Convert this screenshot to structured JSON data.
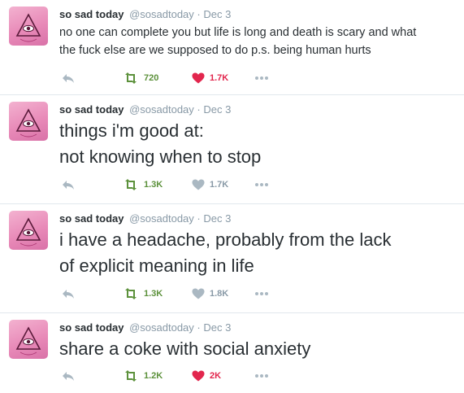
{
  "colors": {
    "retweet": "#5c913b",
    "like_active": "#e2264d",
    "muted": "#8899a6",
    "avatar_pink": "#e88ab8"
  },
  "icons": {
    "reply": "reply-icon",
    "retweet": "retweet-icon",
    "like": "heart-icon",
    "more": "more-dots-icon",
    "avatar": "all-seeing-eye-pyramid-icon"
  },
  "tweets": [
    {
      "fullname": "so sad today",
      "username": "@sosadtoday",
      "separator": "·",
      "time": "Dec 3",
      "text_lines": [
        "no one can complete you but life is long and death is scary and what",
        "the fuck else are we supposed to do p.s. being human hurts"
      ],
      "retweets": "720",
      "likes": "1.7K",
      "liked": true
    },
    {
      "fullname": "so sad today",
      "username": "@sosadtoday",
      "separator": "·",
      "time": "Dec 3",
      "text_lines": [
        "things i'm good at:",
        "not knowing when to stop"
      ],
      "retweets": "1.3K",
      "likes": "1.7K",
      "liked": false
    },
    {
      "fullname": "so sad today",
      "username": "@sosadtoday",
      "separator": "·",
      "time": "Dec 3",
      "text_lines": [
        "i have a headache, probably from the lack",
        "of explicit meaning in life"
      ],
      "retweets": "1.3K",
      "likes": "1.8K",
      "liked": false
    },
    {
      "fullname": "so sad today",
      "username": "@sosadtoday",
      "separator": "·",
      "time": "Dec 3",
      "text_lines": [
        "share a coke with social anxiety"
      ],
      "retweets": "1.2K",
      "likes": "2K",
      "liked": true
    }
  ]
}
